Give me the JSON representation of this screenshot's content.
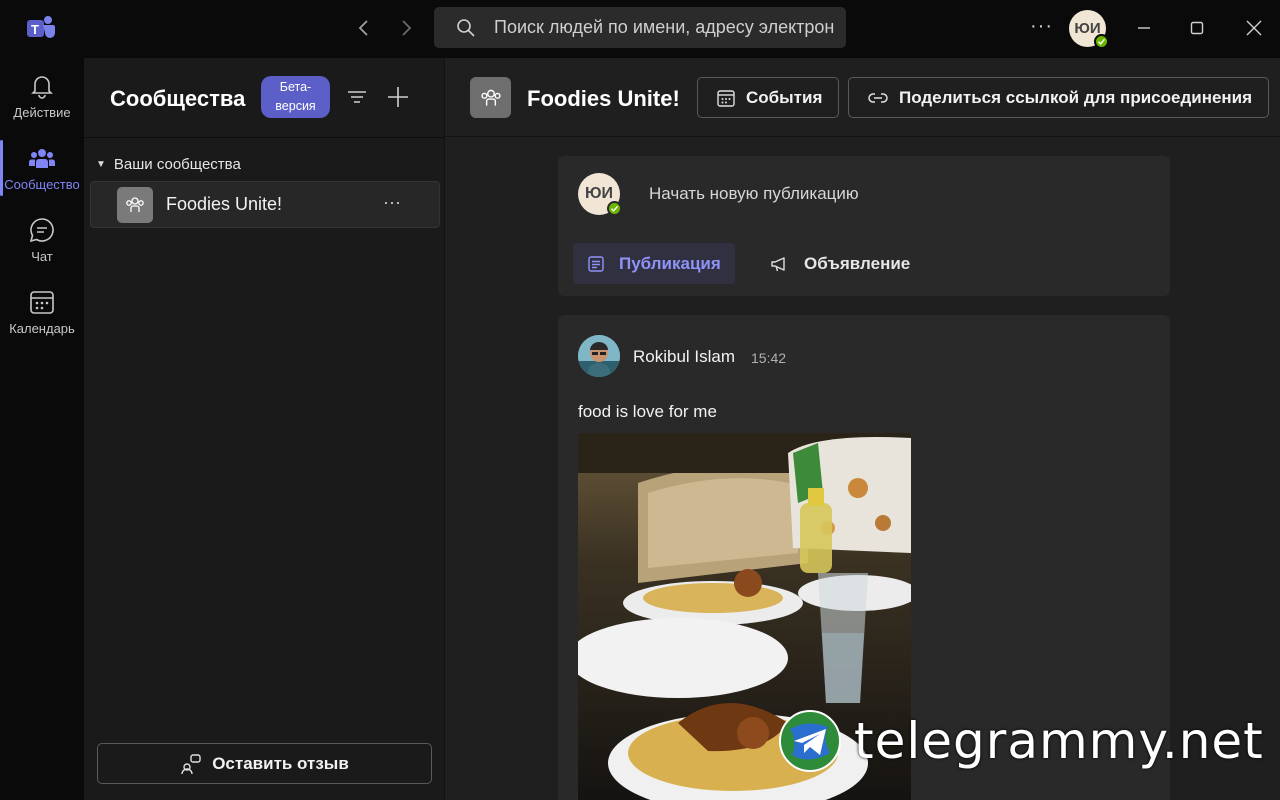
{
  "titlebar": {
    "search_placeholder": "Поиск людей по имени, адресу электронной почты",
    "more_label": "···",
    "user_initials": "ЮИ"
  },
  "rail": {
    "items": [
      {
        "label": "Действие",
        "icon": "bell-icon",
        "active": false
      },
      {
        "label": "Сообщество",
        "icon": "people-icon",
        "active": true
      },
      {
        "label": "Чат",
        "icon": "chat-icon",
        "active": false
      },
      {
        "label": "Календарь",
        "icon": "calendar-icon",
        "active": false
      }
    ]
  },
  "sidebar": {
    "title": "Сообщества",
    "beta_line1": "Бета-",
    "beta_line2": "версия",
    "section_title": "Ваши сообщества",
    "communities": [
      {
        "name": "Foodies Unite!",
        "more": "···"
      }
    ],
    "feedback_label": "Оставить отзыв"
  },
  "main": {
    "title": "Foodies Unite!",
    "events_label": "События",
    "share_label": "Поделиться ссылкой для присоединения",
    "composer": {
      "avatar_initials": "ЮИ",
      "placeholder": "Начать новую публикацию",
      "tab_post": "Публикация",
      "tab_announcement": "Объявление"
    },
    "post": {
      "author": "Rokibul Islam",
      "time": "15:42",
      "text": "food is love for me"
    }
  },
  "watermark": {
    "text": "telegrammy.net"
  },
  "colors": {
    "accent": "#7f85f5",
    "beta_badge": "#5b5fc7",
    "presence": "#6bb700",
    "background": "#1f1f1f",
    "rail": "#0a0a0a"
  }
}
